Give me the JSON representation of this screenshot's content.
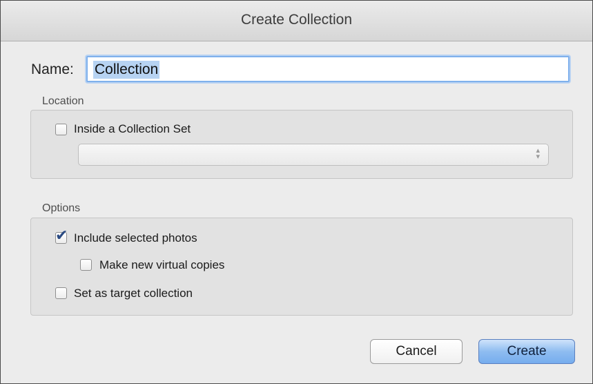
{
  "dialog": {
    "title": "Create Collection",
    "name_label": "Name:",
    "name_value": "Collection",
    "location_label": "Location",
    "inside_set_label": "Inside a Collection Set",
    "inside_set_checked": false,
    "collection_set_value": "",
    "options_label": "Options",
    "include_selected_label": "Include selected photos",
    "include_selected_checked": true,
    "virtual_copies_label": "Make new virtual copies",
    "virtual_copies_checked": false,
    "target_collection_label": "Set as target collection",
    "target_collection_checked": false,
    "cancel_label": "Cancel",
    "create_label": "Create"
  },
  "icons": {
    "check": "checkmark-icon",
    "popup_arrows": "up-down-arrows-icon"
  }
}
